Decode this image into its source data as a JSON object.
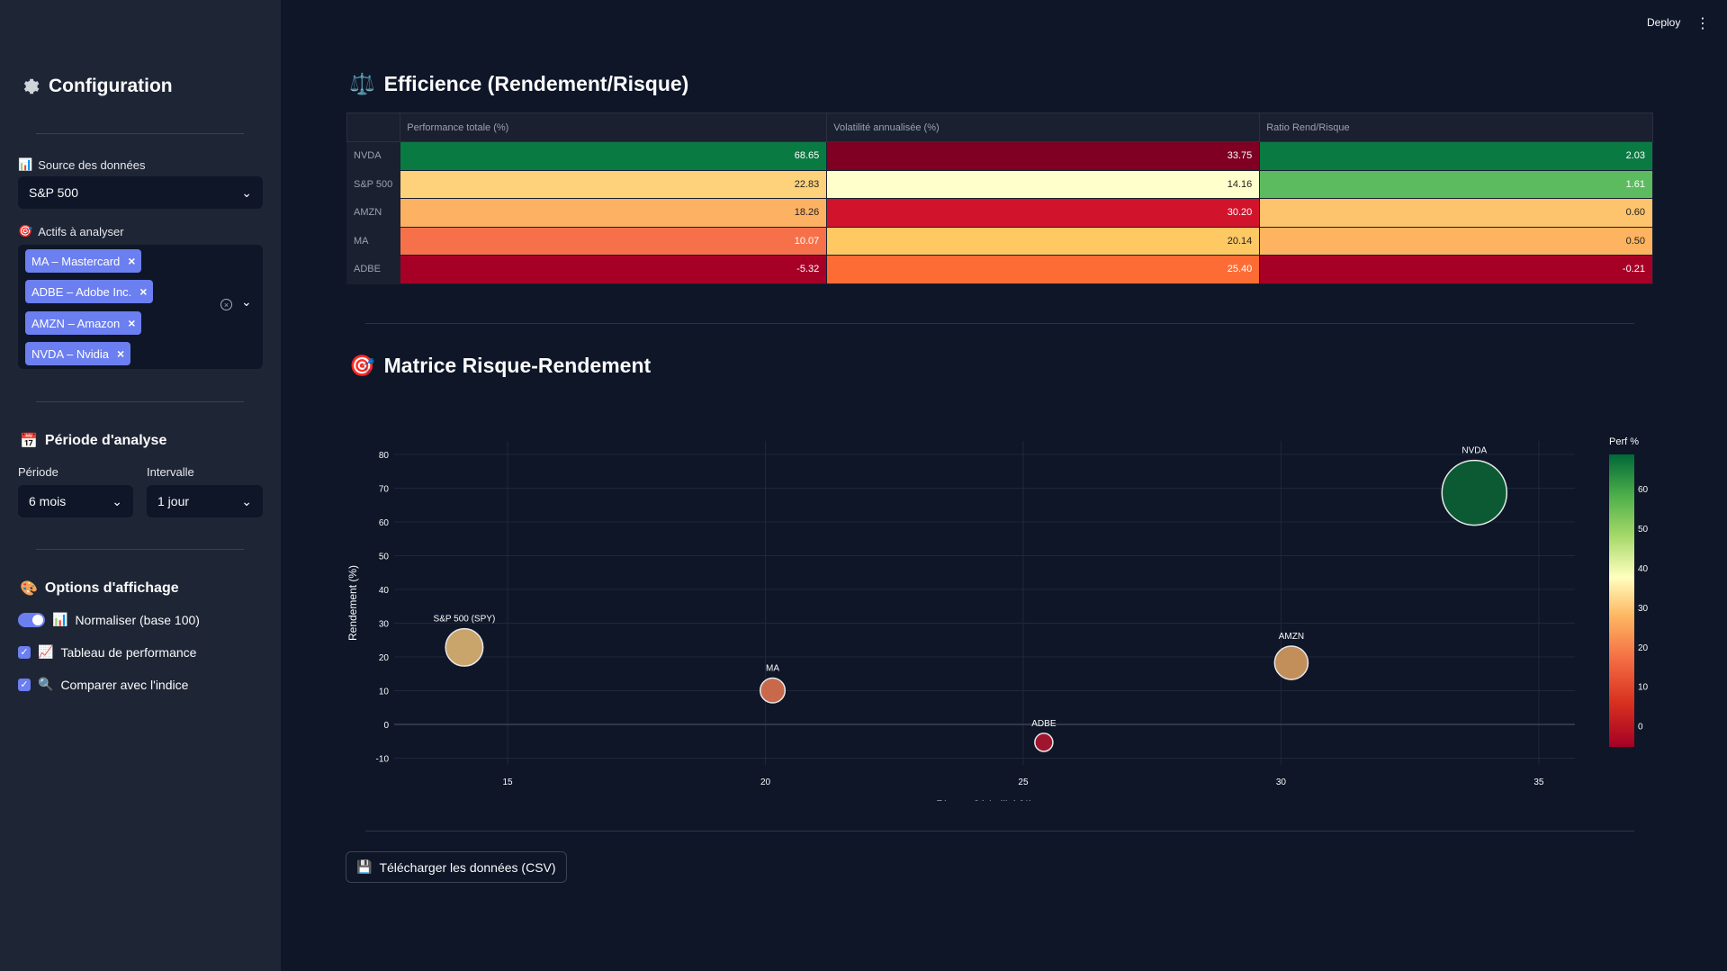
{
  "sidebar": {
    "title": "Configuration",
    "source_label": "Source des données",
    "source_value": "S&P 500",
    "assets_label": "Actifs à analyser",
    "assets": [
      "MA – Mastercard",
      "ADBE – Adobe Inc.",
      "AMZN – Amazon",
      "NVDA – Nvidia"
    ],
    "period_title": "Période d'analyse",
    "period_label": "Période",
    "period_value": "6 mois",
    "interval_label": "Intervalle",
    "interval_value": "1 jour",
    "display_title": "Options d'affichage",
    "opt_normalize": "Normaliser (base 100)",
    "opt_table": "Tableau de performance",
    "opt_compare": "Comparer avec l'indice"
  },
  "header": {
    "deploy": "Deploy",
    "menu_icon": "⋮"
  },
  "efficience": {
    "title": "Efficience (Rendement/Risque)",
    "columns": [
      "Performance totale (%)",
      "Volatilité annualisée (%)",
      "Ratio Rend/Risque"
    ],
    "rows": [
      {
        "label": "NVDA",
        "perf": "68.65",
        "vol": "33.75",
        "ratio": "2.03",
        "c": [
          "#0a7a43",
          "#7f0023",
          "#0a7a43"
        ],
        "t": [
          "#fff",
          "#fff",
          "#fff"
        ]
      },
      {
        "label": "S&P 500",
        "perf": "22.83",
        "vol": "14.16",
        "ratio": "1.61",
        "c": [
          "#fed27a",
          "#ffffcc",
          "#5cbb5f"
        ],
        "t": [
          "#222",
          "#222",
          "#fff"
        ]
      },
      {
        "label": "AMZN",
        "perf": "18.26",
        "vol": "30.20",
        "ratio": "0.60",
        "c": [
          "#fdb163",
          "#d1132b",
          "#fdc36d"
        ],
        "t": [
          "#222",
          "#fff",
          "#222"
        ]
      },
      {
        "label": "MA",
        "perf": "10.07",
        "vol": "20.14",
        "ratio": "0.50",
        "c": [
          "#f6714a",
          "#fec863",
          "#fdb35f"
        ],
        "t": [
          "#fff",
          "#222",
          "#222"
        ]
      },
      {
        "label": "ADBE",
        "perf": "-5.32",
        "vol": "25.40",
        "ratio": "-0.21",
        "c": [
          "#a70026",
          "#fd6c34",
          "#a70026"
        ],
        "t": [
          "#fff",
          "#fff",
          "#fff"
        ]
      }
    ]
  },
  "matrix": {
    "title": "Matrice Risque-Rendement"
  },
  "chart_data": {
    "type": "scatter",
    "xlabel": "Risque (Volatilité %)",
    "ylabel": "Rendement (%)",
    "xlim": [
      12.8,
      35.7
    ],
    "ylim": [
      -12,
      84
    ],
    "xticks": [
      15,
      20,
      25,
      30,
      35
    ],
    "yticks": [
      -10,
      0,
      10,
      20,
      30,
      40,
      50,
      60,
      70,
      80
    ],
    "colorbar_title": "Perf %",
    "colorbar_ticks": [
      0,
      10,
      20,
      30,
      40,
      50,
      60
    ],
    "points": [
      {
        "label": "S&P 500 (SPY)",
        "x": 14.16,
        "y": 22.83,
        "color": "#c9a46b"
      },
      {
        "label": "MA",
        "x": 20.14,
        "y": 10.07,
        "color": "#c8694c"
      },
      {
        "label": "ADBE",
        "x": 25.4,
        "y": -5.32,
        "color": "#a0152e"
      },
      {
        "label": "AMZN",
        "x": 30.2,
        "y": 18.26,
        "color": "#c28e5a"
      },
      {
        "label": "NVDA",
        "x": 33.75,
        "y": 68.65,
        "color": "#0b5a33"
      }
    ]
  },
  "download": {
    "label": "Télécharger les données (CSV)"
  }
}
